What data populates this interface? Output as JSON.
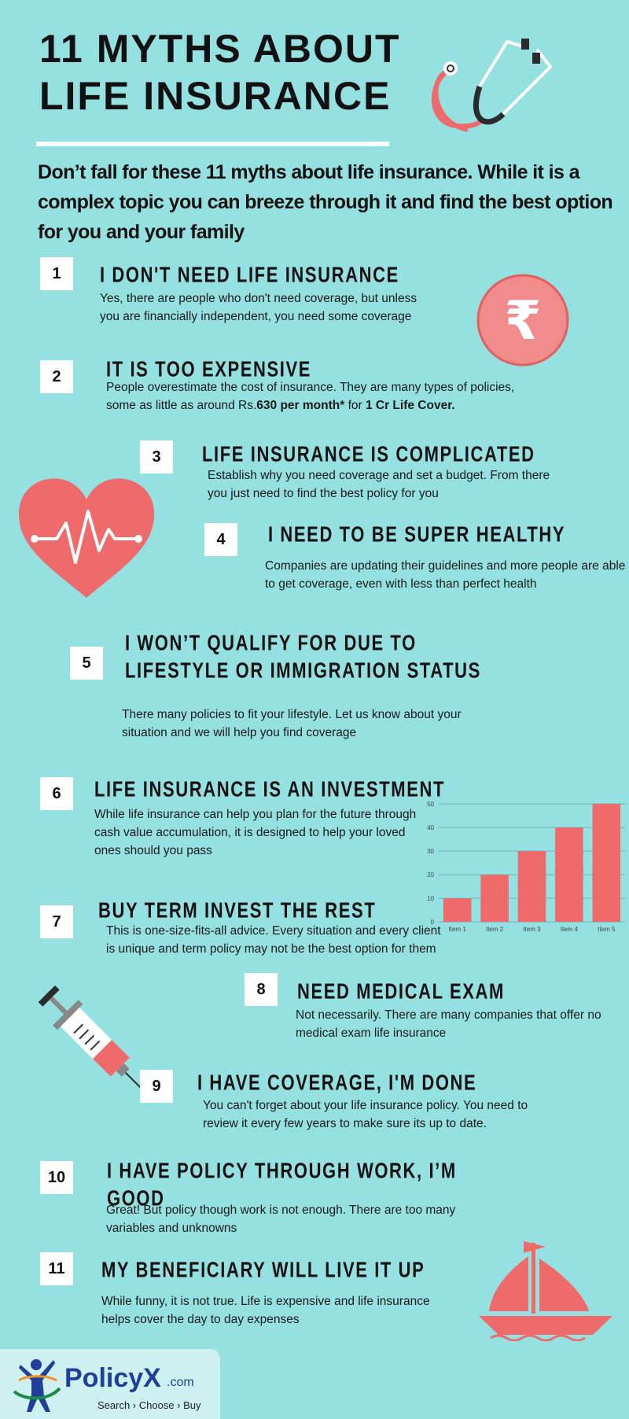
{
  "title": {
    "line1": "11 MYTHS ABOUT",
    "line2": "LIFE INSURANCE"
  },
  "intro": "Don’t fall for these 11 myths about life insurance. While it is a complex topic you can breeze through it and find the best option for you and your family",
  "colors": {
    "background": "#95e0e0",
    "accent": "#ef6b6b",
    "text": "#111111"
  },
  "myths": [
    {
      "num": "1",
      "head": "I don't need life insurance",
      "body": "Yes, there are people who don't need coverage, but unless you are financially independent, you need some coverage"
    },
    {
      "num": "2",
      "head": "It is too expensive",
      "body": "People overestimate the cost of insurance. They are many types of policies, some as little as",
      "body_plain2": " around Rs.",
      "body_bold1": "630 per month*",
      "body_plain3": " for ",
      "body_bold2": "1 Cr Life Cover."
    },
    {
      "num": "3",
      "head": "Life insurance is complicated",
      "body": "Establish why you need coverage and set a budget. From there you just need to find the best policy for you"
    },
    {
      "num": "4",
      "head": "I need to be super healthy",
      "body": "Companies are updating their guidelines and more people are able to get coverage, even with less than perfect health"
    },
    {
      "num": "5",
      "head": "I won’t qualify for due to lifestyle or immigration status",
      "body": "There many policies to fit your lifestyle. Let us know about your situation and we will help you find coverage"
    },
    {
      "num": "6",
      "head": "Life insurance is an investment",
      "body": "While life insurance can help you plan for the future through cash value accumulation, it is designed to help your loved ones should you pass"
    },
    {
      "num": "7",
      "head": "Buy term invest the rest",
      "body": "This is one-size-fits-all advice. Every situation and every client is unique and term policy may not be the best option for them"
    },
    {
      "num": "8",
      "head": "Need medical exam",
      "body": "Not necessarily. There are many companies that offer no medical exam life insurance"
    },
    {
      "num": "9",
      "head": "I have coverage, I'm done",
      "body": "You can't forget about your life insurance policy. You need to review it every few years to make sure its up to date."
    },
    {
      "num": "10",
      "head": "I have policy through work, I’m good",
      "body": "Great! But policy though work is not enough. There are too many variables and unknowns"
    },
    {
      "num": "11",
      "head": "My beneficiary will live it up",
      "body": "While funny, it is not true. Life is expensive and life insurance helps cover the day to day expenses"
    }
  ],
  "icons": [
    "stethoscope-icon",
    "rupee-icon",
    "heartbeat-icon",
    "syringe-icon",
    "sailboat-icon"
  ],
  "chart_data": {
    "type": "bar",
    "categories": [
      "Item 1",
      "Item 2",
      "Item 3",
      "Item 4",
      "Item 5"
    ],
    "values": [
      10,
      20,
      30,
      40,
      50
    ],
    "ylim": [
      0,
      50
    ],
    "yticks": [
      0,
      10,
      20,
      30,
      40,
      50
    ],
    "grid": true,
    "color": "#ef6b6b"
  },
  "logo": {
    "brand": "PolicyX",
    "suffix": ".com",
    "tagline": "Search › Choose › Buy"
  }
}
